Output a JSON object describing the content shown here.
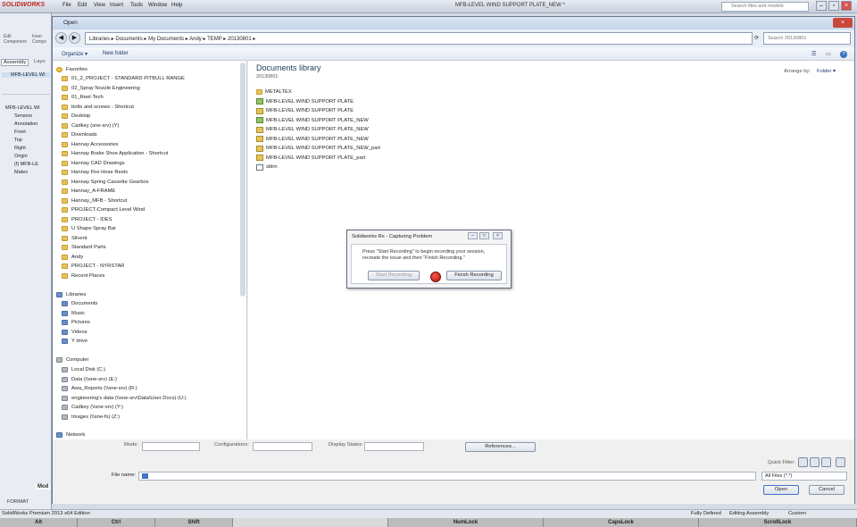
{
  "app": {
    "logo": "SOLIDWORKS",
    "menu": [
      "File",
      "Edit",
      "View",
      "Insert",
      "Tools",
      "Window",
      "Help"
    ],
    "doc_title": "MFB-LEVEL WIND SUPPORT PLATE_NEW *",
    "search_placeholder": "Search files and models"
  },
  "sw_left": {
    "tool_labels": [
      "Edit Component",
      "Inser Compo"
    ],
    "tabs": [
      "Assembly",
      "Layo"
    ],
    "root": "MFB-LEVEL WI",
    "tree": [
      "MFB-LEVEL WI",
      "Sensors",
      "Annotation",
      "Front",
      "Top",
      "Right",
      "Origin",
      "(f) MFB-LE",
      "Mates"
    ],
    "bottom_tab": "Mod",
    "format": "FORMAT"
  },
  "dialog": {
    "title": "Open",
    "address": [
      "Libraries",
      "Documents",
      "My Documents",
      "Andy",
      "TEMP",
      "20130801"
    ],
    "search_placeholder": "Search 20130801",
    "organize": "Organize ▾",
    "new_folder": "New folder",
    "nav": {
      "favorites_label": "Favorites",
      "favorites": [
        "01_2_PROJECT - STANDARD PITBULL RANGE",
        "02_Spray Nozzle Engineering",
        "01_Reel-Tech",
        "bolts and screws - Shortcut",
        "Desktop",
        "Cadkey (sne-srv) (Y)",
        "Downloads",
        "Hannay Accessories",
        "Hannay Brake Shoe Application - Shortcut",
        "Hannay CAD Drawings",
        "Hannay Fire Hose Reels",
        "Hannay Spring Cassette Gearbox",
        "Hannay_A-FRAME",
        "Hannay_MFB - Shortcut",
        "PROJECT-Compact Level Wind",
        "PROJECT - IDES",
        "U Shape Spray Bar",
        "Silvent",
        "Standard Parts",
        "Andy",
        "PROJECT - NYRSTAR",
        "Recent Places"
      ],
      "libraries_label": "Libraries",
      "libraries": [
        "Documents",
        "Music",
        "Pictures",
        "Videos",
        "Y drive"
      ],
      "computer_label": "Computer",
      "computer": [
        "Local Disk (C:)",
        "Data (\\\\sne-srv) (E:)",
        "Awa_Reports (\\\\sne-srv) (R:)",
        "engineering's data (\\\\sne-srv\\Data\\User Docs) (U:)",
        "Cadkey (\\\\sne-srv) (Y:)",
        "Images (\\\\sne-fs) (Z:)"
      ],
      "network_label": "Network"
    },
    "library_title": "Documents library",
    "library_sub": "20130801",
    "arrange_by_label": "Arrange by:",
    "arrange_by_value": "Folder ▾",
    "files": [
      "METALTEX",
      "MFB-LEVEL WIND SUPPORT PLATE",
      "MFB-LEVEL WIND SUPPORT PLATE",
      "MFB-LEVEL WIND SUPPORT PLATE_NEW",
      "MFB-LEVEL WIND SUPPORT PLATE_NEW",
      "MFB-LEVEL WIND SUPPORT PLATE_NEW",
      "MFB-LEVEL WIND SUPPORT PLATE_NEW_part",
      "MFB-LEVEL WIND SUPPORT PLATE_part",
      "sldrn"
    ],
    "mode_label": "Mode:",
    "configurations_label": "Configurations:",
    "display_states_label": "Display States:",
    "references_button": "References...",
    "quick_filter_label": "Quick Filter:",
    "file_name_label": "File name:",
    "file_type": "All Files (*.*)",
    "open_button": "Open",
    "cancel_button": "Cancel"
  },
  "recorder": {
    "title": "Solidworks Rx - Capturing Problem",
    "message": "Press \"Start Recording\" to begin recording your session, recreate the issue and then \"Finish Recording.\"",
    "start_button": "Start Recording",
    "finish_button": "Finish Recording"
  },
  "status": {
    "edition": "SolidWorks Premium 2013 x64 Edition",
    "state": "Fully Defined",
    "mode": "Editing Assembly",
    "units": "Custom"
  },
  "keys": [
    "Alt",
    "Ctrl",
    "Shift",
    "",
    "NumLock",
    "CapsLock",
    "ScrollLock"
  ]
}
